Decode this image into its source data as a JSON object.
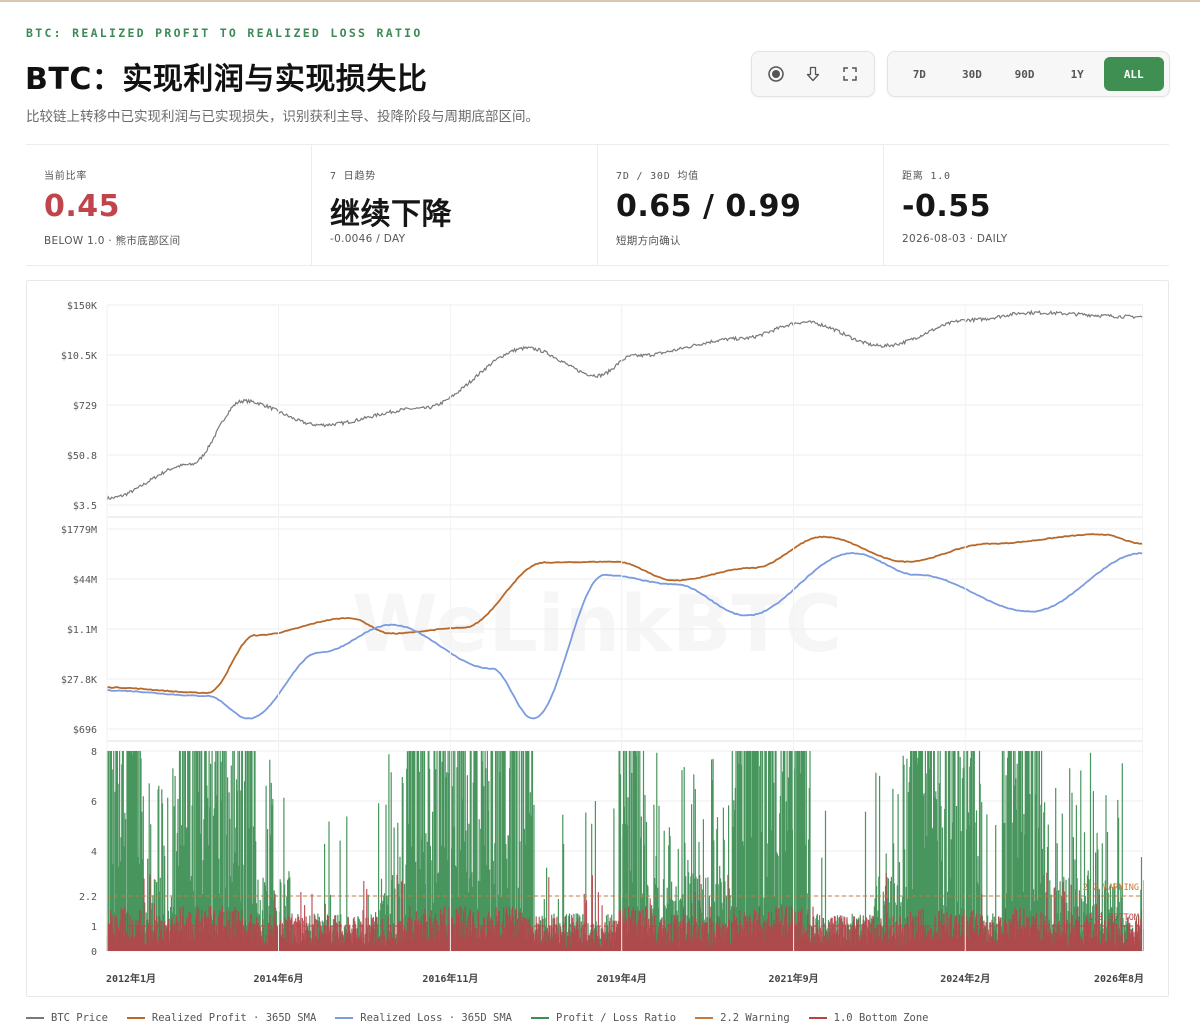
{
  "header": {
    "eyebrow": "BTC: REALIZED PROFIT TO REALIZED LOSS RATIO",
    "title": "BTC：实现利润与实现损失比",
    "subtitle": "比较链上转移中已实现利润与已实现损失，识别获利主导、投降阶段与周期底部区间。"
  },
  "toolbar": {
    "icons": [
      "record-icon",
      "download-icon",
      "fullscreen-icon"
    ],
    "ranges": [
      "7D",
      "30D",
      "90D",
      "1Y",
      "ALL"
    ],
    "active_range": "ALL",
    "accent": "#3f8f52"
  },
  "stats": [
    {
      "label": "当前比率",
      "value": "0.45",
      "sub": "BELOW 1.0 · 熊市底部区间",
      "color": "#c0444b"
    },
    {
      "label": "7 日趋势",
      "value": "继续下降",
      "sub": "-0.0046 / DAY"
    },
    {
      "label": "7D / 30D 均值",
      "value": "0.65 / 0.99",
      "sub": "短期方向确认"
    },
    {
      "label": "距离 1.0",
      "value": "-0.55",
      "sub": "2026-08-03 · DAILY"
    }
  ],
  "chart_data": [
    {
      "type": "line",
      "series": [
        {
          "name": "BTC Price",
          "color": "#7a7a7a"
        }
      ],
      "y_scale": "log",
      "yticks": [
        "$150K",
        "$10.5K",
        "$729",
        "$50.8",
        "$3.5"
      ],
      "anchors": [
        {
          "x": "2012-01",
          "y": 5
        },
        {
          "x": "2013-03",
          "y": 30
        },
        {
          "x": "2013-12",
          "y": 900
        },
        {
          "x": "2015-01",
          "y": 250
        },
        {
          "x": "2016-06",
          "y": 600
        },
        {
          "x": "2017-12",
          "y": 15000
        },
        {
          "x": "2018-12",
          "y": 3500
        },
        {
          "x": "2019-06",
          "y": 10000
        },
        {
          "x": "2020-12",
          "y": 25000
        },
        {
          "x": "2021-11",
          "y": 60000
        },
        {
          "x": "2022-12",
          "y": 17000
        },
        {
          "x": "2024-03",
          "y": 68000
        },
        {
          "x": "2025-01",
          "y": 100000
        },
        {
          "x": "2026-08",
          "y": 80000
        }
      ]
    },
    {
      "type": "line",
      "y_scale": "log",
      "yticks": [
        "$1779M",
        "$44M",
        "$1.1M",
        "$27.8K",
        "$696"
      ],
      "series": [
        {
          "name": "Realized Profit · 365D SMA",
          "color": "#b8692a",
          "anchors": [
            {
              "x": "2012-01",
              "y": 15000
            },
            {
              "x": "2013-06",
              "y": 10000
            },
            {
              "x": "2014-02",
              "y": 700000
            },
            {
              "x": "2015-06",
              "y": 2500000
            },
            {
              "x": "2016-01",
              "y": 800000
            },
            {
              "x": "2017-01",
              "y": 1200000
            },
            {
              "x": "2018-03",
              "y": 150000000
            },
            {
              "x": "2019-03",
              "y": 160000000
            },
            {
              "x": "2020-01",
              "y": 40000000
            },
            {
              "x": "2021-02",
              "y": 100000000
            },
            {
              "x": "2022-02",
              "y": 1000000000
            },
            {
              "x": "2023-04",
              "y": 160000000
            },
            {
              "x": "2024-06",
              "y": 600000000
            },
            {
              "x": "2026-01",
              "y": 1200000000
            },
            {
              "x": "2026-08",
              "y": 600000000
            }
          ]
        },
        {
          "name": "Realized Loss · 365D SMA",
          "color": "#7b9be0",
          "anchors": [
            {
              "x": "2012-01",
              "y": 12000
            },
            {
              "x": "2013-06",
              "y": 8000
            },
            {
              "x": "2014-01",
              "y": 1500
            },
            {
              "x": "2015-01",
              "y": 200000
            },
            {
              "x": "2016-01",
              "y": 1500000
            },
            {
              "x": "2017-06",
              "y": 60000
            },
            {
              "x": "2018-01",
              "y": 1500
            },
            {
              "x": "2019-01",
              "y": 60000000
            },
            {
              "x": "2020-01",
              "y": 30000000
            },
            {
              "x": "2021-01",
              "y": 3000000
            },
            {
              "x": "2022-07",
              "y": 300000000
            },
            {
              "x": "2023-06",
              "y": 60000000
            },
            {
              "x": "2025-01",
              "y": 4000000
            },
            {
              "x": "2026-08",
              "y": 300000000
            }
          ]
        }
      ]
    },
    {
      "type": "area",
      "series": [
        {
          "name": "Profit / Loss Ratio",
          "color": "#3e8f55"
        },
        {
          "name": "2.2 Warning",
          "value": 2.2,
          "color": "#c47a3a"
        },
        {
          "name": "1.0 Bottom Zone",
          "value": 1.0,
          "color": "#b8434a"
        }
      ],
      "yticks": [
        8,
        6,
        4,
        2.2,
        1,
        0
      ],
      "ylim": [
        0,
        8
      ],
      "annotations": [
        "2.2 WARNING",
        "1.0 BOTTOM"
      ],
      "xticks": [
        "2012年1月",
        "2014年6月",
        "2016年11月",
        "2019年4月",
        "2021年9月",
        "2024年2月",
        "2026年8月"
      ]
    }
  ],
  "watermark": "WeLinkBTC",
  "legend": [
    {
      "label": "BTC Price",
      "color": "#7a7a7a"
    },
    {
      "label": "Realized Profit · 365D SMA",
      "color": "#b8692a"
    },
    {
      "label": "Realized Loss · 365D SMA",
      "color": "#7b9be0"
    },
    {
      "label": "Profit / Loss Ratio",
      "color": "#3e8f55"
    },
    {
      "label": "2.2 Warning",
      "color": "#c47a3a"
    },
    {
      "label": "1.0 Bottom Zone",
      "color": "#b8434a"
    }
  ]
}
